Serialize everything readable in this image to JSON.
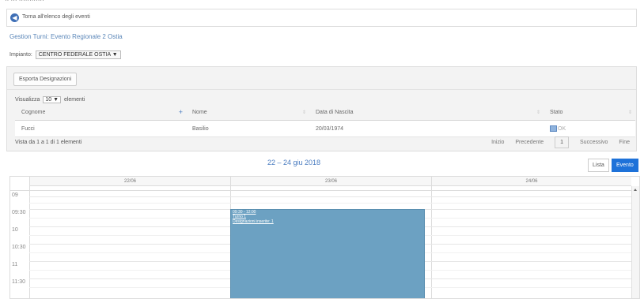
{
  "top_strip": {
    "text": "··  ···  ············"
  },
  "back_link": {
    "icon": "back-arrow-icon",
    "label": "Torna all'elenco degli eventi"
  },
  "page_title": "Gestion Turni: Evento Regionale 2 Ostia",
  "plant": {
    "label": "Impianto:",
    "selected": "CENTRO FEDERALE OSTIA"
  },
  "export_button": "Esporta Designazioni",
  "length_control": {
    "prefix": "Visualizza",
    "value": "10",
    "suffix": "elementi"
  },
  "table": {
    "columns": [
      "Cognome",
      "Nome",
      "Data di Nascita",
      "Stato"
    ],
    "rows": [
      {
        "cognome": "Fucci",
        "nome": "Basilio",
        "data": "20/03/1974",
        "stato": "OK"
      }
    ]
  },
  "info": "Vista da 1 a 1 di 1 elementi",
  "pager": {
    "first": "Inizio",
    "prev": "Precedente",
    "current": "1",
    "next": "Successivo",
    "last": "Fine"
  },
  "calendar": {
    "range_title": "22 – 24 giu 2018",
    "view_buttons": {
      "lista": "Lista",
      "evento": "Evento"
    },
    "days": [
      "22/06",
      "23/06",
      "24/06"
    ],
    "slots": [
      "09",
      "09:30",
      "10",
      "10:30",
      "11",
      "11:30"
    ],
    "event_lines": [
      "09:30 - 12:00",
      "Turno 1",
      "Designazioni inserite: 1"
    ]
  },
  "colors": {
    "accent": "#1e72d9",
    "title": "#5a86b8",
    "event": "#6ca1c2"
  }
}
